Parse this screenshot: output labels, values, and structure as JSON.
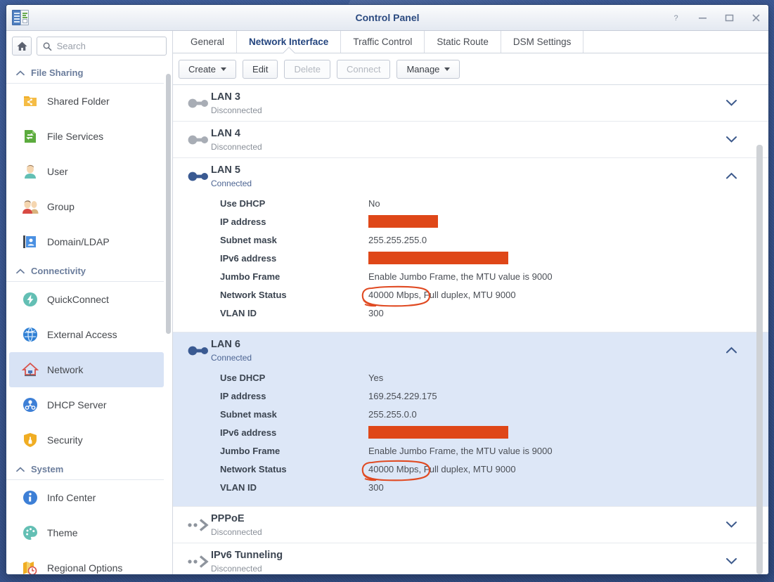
{
  "window": {
    "title": "Control Panel",
    "app_icon": "control-panel-icon",
    "controls": [
      {
        "name": "help-button",
        "glyph": "?"
      },
      {
        "name": "minimize-button",
        "glyph": "–"
      },
      {
        "name": "maximize-button",
        "glyph": "□"
      },
      {
        "name": "close-button",
        "glyph": "✕"
      }
    ]
  },
  "sidebar": {
    "home_button": "home-icon",
    "search": {
      "value": "",
      "placeholder": "Search"
    },
    "groups": [
      {
        "label": "File Sharing",
        "items": [
          {
            "label": "Shared Folder",
            "icon": "shared-folder-icon"
          },
          {
            "label": "File Services",
            "icon": "file-services-icon"
          },
          {
            "label": "User",
            "icon": "user-icon"
          },
          {
            "label": "Group",
            "icon": "group-icon"
          },
          {
            "label": "Domain/LDAP",
            "icon": "domain-ldap-icon"
          }
        ]
      },
      {
        "label": "Connectivity",
        "items": [
          {
            "label": "QuickConnect",
            "icon": "quickconnect-icon"
          },
          {
            "label": "External Access",
            "icon": "external-access-icon"
          },
          {
            "label": "Network",
            "icon": "network-icon",
            "active": true
          },
          {
            "label": "DHCP Server",
            "icon": "dhcp-server-icon"
          },
          {
            "label": "Security",
            "icon": "security-icon"
          }
        ]
      },
      {
        "label": "System",
        "items": [
          {
            "label": "Info Center",
            "icon": "info-center-icon"
          },
          {
            "label": "Theme",
            "icon": "theme-icon"
          },
          {
            "label": "Regional Options",
            "icon": "regional-options-icon"
          }
        ]
      }
    ]
  },
  "main": {
    "tabs": [
      {
        "label": "General",
        "active": false
      },
      {
        "label": "Network Interface",
        "active": true
      },
      {
        "label": "Traffic Control",
        "active": false
      },
      {
        "label": "Static Route",
        "active": false
      },
      {
        "label": "DSM Settings",
        "active": false
      }
    ],
    "toolbar": [
      {
        "label": "Create",
        "has_caret": true,
        "disabled": false,
        "name": "create-button"
      },
      {
        "label": "Edit",
        "has_caret": false,
        "disabled": false,
        "name": "edit-button"
      },
      {
        "label": "Delete",
        "has_caret": false,
        "disabled": true,
        "name": "delete-button"
      },
      {
        "label": "Connect",
        "has_caret": false,
        "disabled": true,
        "name": "connect-button"
      },
      {
        "label": "Manage",
        "has_caret": true,
        "disabled": false,
        "name": "manage-button"
      }
    ],
    "interfaces": [
      {
        "name": "LAN 3",
        "status": "Disconnected",
        "connected": false,
        "expanded": false,
        "selected": false,
        "icon": "lan-disconnected-icon",
        "chevron": "chevron-down-icon",
        "details": []
      },
      {
        "name": "LAN 4",
        "status": "Disconnected",
        "connected": false,
        "expanded": false,
        "selected": false,
        "icon": "lan-disconnected-icon",
        "chevron": "chevron-down-icon",
        "details": []
      },
      {
        "name": "LAN 5",
        "status": "Connected",
        "connected": true,
        "expanded": true,
        "selected": false,
        "icon": "lan-connected-icon",
        "chevron": "chevron-up-icon",
        "details": [
          {
            "label": "Use DHCP",
            "value": "No"
          },
          {
            "label": "IP address",
            "value": "",
            "redacted": true,
            "redact_width": 99
          },
          {
            "label": "Subnet mask",
            "value": "255.255.255.0"
          },
          {
            "label": "IPv6 address",
            "value": "",
            "redacted": true,
            "redact_width": 199
          },
          {
            "label": "Jumbo Frame",
            "value": "Enable Jumbo Frame, the MTU value is 9000"
          },
          {
            "label": "Network Status",
            "value": "40000 Mbps, Full duplex, MTU 9000",
            "annotated": "40000 Mbps,",
            "annotation_rest": " Full duplex, MTU 9000"
          },
          {
            "label": "VLAN ID",
            "value": "300"
          }
        ]
      },
      {
        "name": "LAN 6",
        "status": "Connected",
        "connected": true,
        "expanded": true,
        "selected": true,
        "icon": "lan-connected-icon",
        "chevron": "chevron-up-icon",
        "details": [
          {
            "label": "Use DHCP",
            "value": "Yes"
          },
          {
            "label": "IP address",
            "value": "169.254.229.175"
          },
          {
            "label": "Subnet mask",
            "value": "255.255.0.0"
          },
          {
            "label": "IPv6 address",
            "value": "",
            "redacted": true,
            "redact_width": 199
          },
          {
            "label": "Jumbo Frame",
            "value": "Enable Jumbo Frame, the MTU value is 9000"
          },
          {
            "label": "Network Status",
            "value": "40000 Mbps, Full duplex, MTU 9000",
            "annotated": "40000 Mbps,",
            "annotation_rest": " Full duplex, MTU 9000"
          },
          {
            "label": "VLAN ID",
            "value": "300"
          }
        ]
      },
      {
        "name": "PPPoE",
        "status": "Disconnected",
        "connected": false,
        "expanded": false,
        "selected": false,
        "icon": "tunnel-icon",
        "chevron": "chevron-down-icon",
        "details": []
      },
      {
        "name": "IPv6 Tunneling",
        "status": "Disconnected",
        "connected": false,
        "expanded": false,
        "selected": false,
        "icon": "tunnel-icon",
        "chevron": "chevron-down-icon",
        "details": []
      }
    ]
  },
  "colors": {
    "accent": "#23447e",
    "redaction": "#df4718",
    "annotation": "#e04a22",
    "selected_row": "#dde7f7",
    "sidebar_active": "#d8e3f5"
  }
}
